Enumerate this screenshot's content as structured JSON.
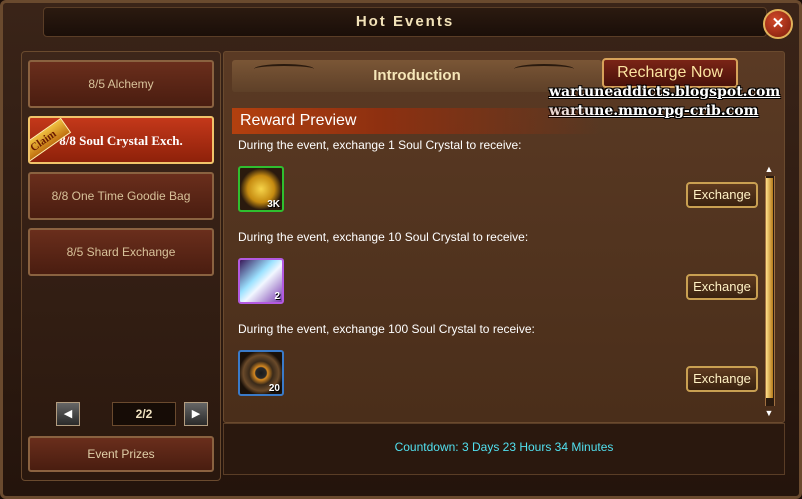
{
  "window": {
    "title": "Hot Events",
    "close_label": "✕"
  },
  "sidebar": {
    "items": [
      {
        "label": "8/5 Alchemy",
        "active": false
      },
      {
        "label": "8/8 Soul Crystal Exch.",
        "active": true,
        "badge": "Claim"
      },
      {
        "label": "8/8 One Time Goodie Bag",
        "active": false
      },
      {
        "label": "8/5 Shard Exchange",
        "active": false
      }
    ],
    "pager": {
      "prev": "◀",
      "next": "▶",
      "page": "2/2"
    },
    "prizes_label": "Event Prizes"
  },
  "main": {
    "intro_label": "Introduction",
    "recharge_label": "Recharge Now",
    "watermark": [
      "wartuneaddicts.blogspot.com",
      "wartune.mmorpg-crib.com"
    ],
    "reward_header": "Reward Preview",
    "rewards": [
      {
        "text": "During the event, exchange 1 Soul Crystal to receive:",
        "count": "3K",
        "icon": "gold-coin-icon",
        "button": "Exchange"
      },
      {
        "text": "During the event, exchange 10 Soul Crystal to receive:",
        "count": "2",
        "icon": "crystal-shard-icon",
        "button": "Exchange"
      },
      {
        "text": "During the event, exchange 100 Soul Crystal to receive:",
        "count": "20",
        "icon": "rune-disc-icon",
        "button": "Exchange"
      }
    ],
    "scroll": {
      "up": "▲",
      "down": "▼"
    }
  },
  "countdown": "Countdown: 3 Days 23 Hours 34 Minutes",
  "colors": {
    "accent": "#c4381a",
    "countdown": "#51e0ef",
    "frame": "#6a4a2e"
  }
}
